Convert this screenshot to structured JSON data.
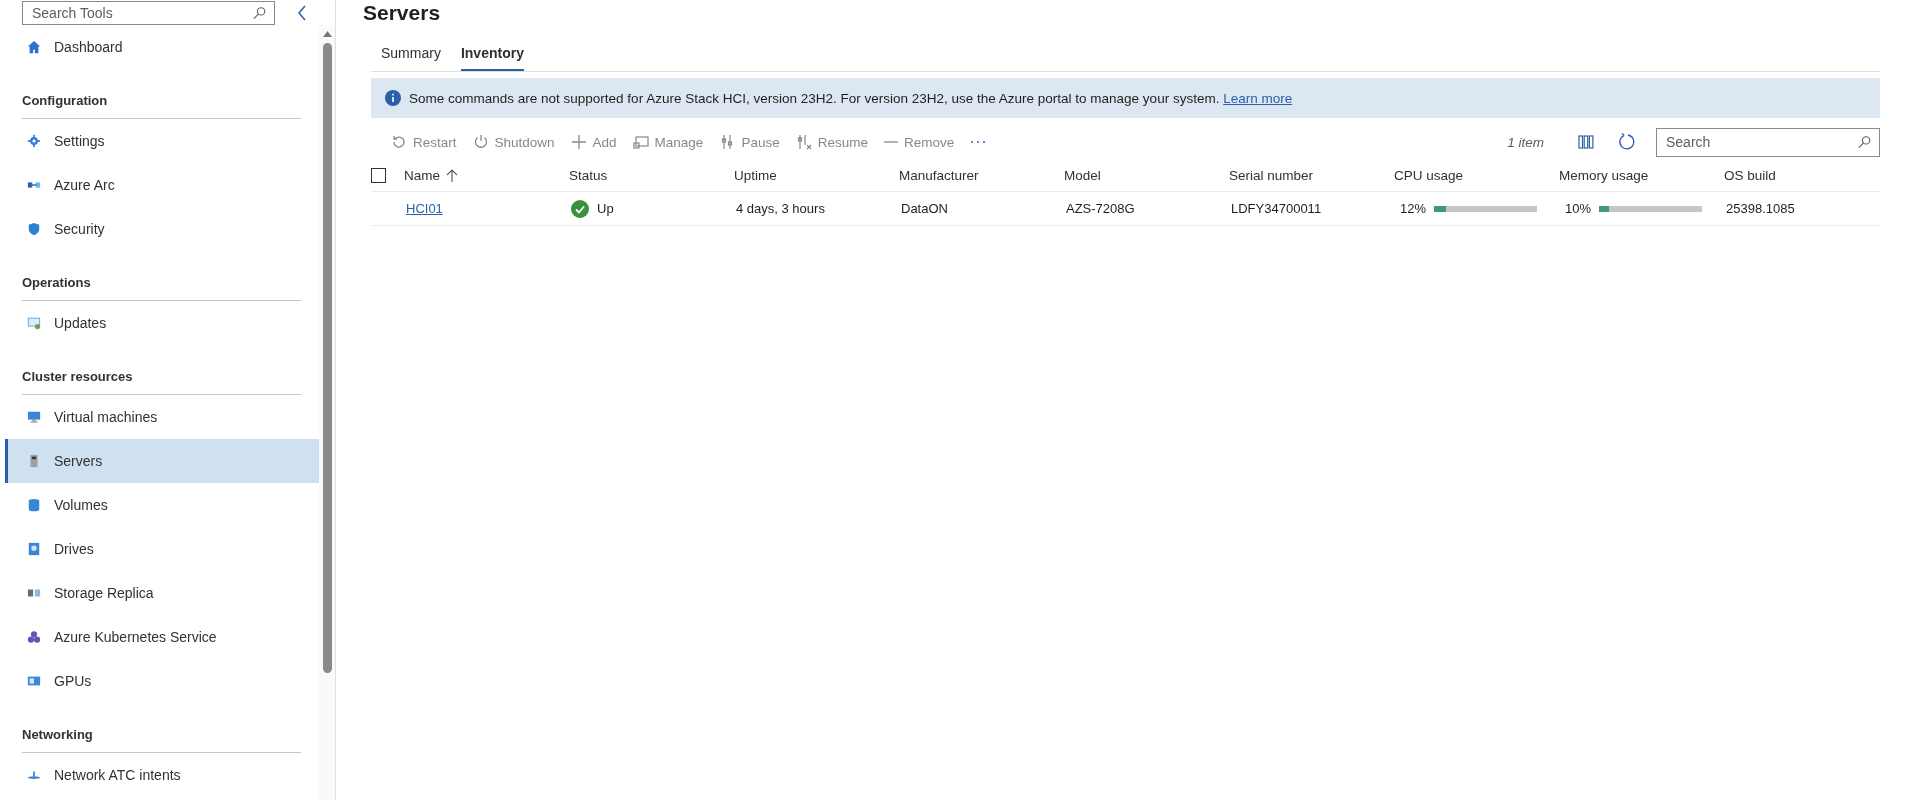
{
  "sidebar": {
    "search": {
      "placeholder": "Search Tools"
    },
    "sections": [
      {
        "items": [
          {
            "label": "Dashboard",
            "selected": false
          }
        ]
      },
      {
        "heading": "Configuration",
        "items": [
          {
            "label": "Settings",
            "selected": false
          },
          {
            "label": "Azure Arc",
            "selected": false
          },
          {
            "label": "Security",
            "selected": false
          }
        ]
      },
      {
        "heading": "Operations",
        "items": [
          {
            "label": "Updates",
            "selected": false
          }
        ]
      },
      {
        "heading": "Cluster resources",
        "items": [
          {
            "label": "Virtual machines",
            "selected": false
          },
          {
            "label": "Servers",
            "selected": true
          },
          {
            "label": "Volumes",
            "selected": false
          },
          {
            "label": "Drives",
            "selected": false
          },
          {
            "label": "Storage Replica",
            "selected": false
          },
          {
            "label": "Azure Kubernetes Service",
            "selected": false
          },
          {
            "label": "GPUs",
            "selected": false
          }
        ]
      },
      {
        "heading": "Networking",
        "items": [
          {
            "label": "Network ATC intents",
            "selected": false
          }
        ]
      }
    ]
  },
  "page": {
    "title": "Servers",
    "tabs": [
      {
        "label": "Summary",
        "selected": false
      },
      {
        "label": "Inventory",
        "selected": true
      }
    ],
    "banner": {
      "text": "Some commands are not supported for Azure Stack HCI, version 23H2. For version 23H2, use the Azure portal to manage your system.",
      "link": "Learn more"
    },
    "toolbar": {
      "actions": [
        {
          "label": "Restart",
          "disabled": true
        },
        {
          "label": "Shutdown",
          "disabled": true
        },
        {
          "label": "Add",
          "disabled": true
        },
        {
          "label": "Manage",
          "disabled": true
        },
        {
          "label": "Pause",
          "disabled": true
        },
        {
          "label": "Resume",
          "disabled": true
        },
        {
          "label": "Remove",
          "disabled": true
        }
      ],
      "count": "1 item",
      "search": {
        "placeholder": "Search"
      }
    },
    "table": {
      "select_all": {
        "checked": false
      },
      "columns": [
        "Name",
        "Status",
        "Uptime",
        "Manufacturer",
        "Model",
        "Serial number",
        "CPU usage",
        "Memory usage",
        "OS build"
      ],
      "rows": [
        {
          "name": "HCI01",
          "status": {
            "kind": "up",
            "label": "Up"
          },
          "uptime": "4 days, 3 hours",
          "manufacturer": "DataON",
          "model": "AZS-7208G",
          "serial": "LDFY34700011",
          "cpu": {
            "reading": "12%",
            "level": 0.12
          },
          "memory": {
            "reading": "10%",
            "level": 0.1
          },
          "os_build": "25398.1085"
        }
      ]
    }
  }
}
